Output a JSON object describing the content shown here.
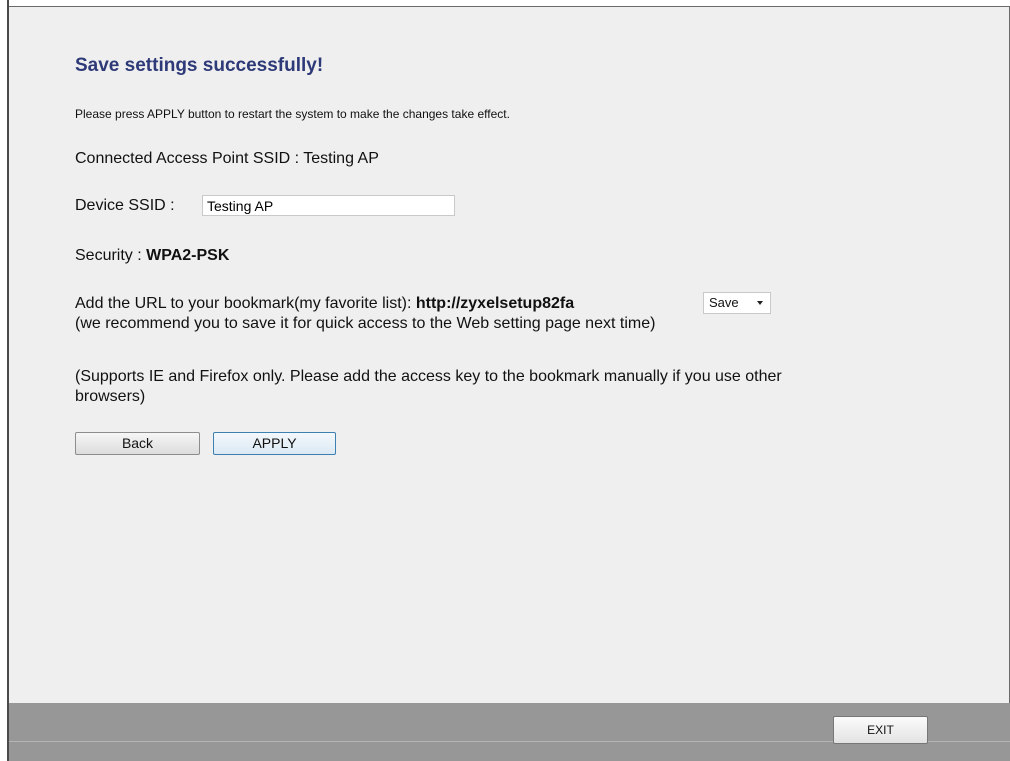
{
  "page": {
    "title": "Save settings successfully!",
    "instruction": "Please press APPLY button to restart the system to make the changes take effect."
  },
  "connection": {
    "ap_label": "Connected Access Point SSID : ",
    "ap_value": "Testing AP"
  },
  "device_ssid": {
    "label": "Device SSID : ",
    "value": "Testing AP"
  },
  "security": {
    "label": "Security : ",
    "value": "WPA2-PSK"
  },
  "bookmark": {
    "label": "Add the URL to your bookmark(my favorite list): ",
    "url": "http://zyxelsetup82fa",
    "select_value": "Save",
    "recommend": "(we recommend you to save it for quick access to the Web setting page next time)"
  },
  "support": {
    "line1": "(Supports IE and Firefox only. Please add the access key to the bookmark manually if you use other",
    "line2": "browsers)"
  },
  "buttons": {
    "back": "Back",
    "apply": "APPLY",
    "exit": "EXIT"
  },
  "colors": {
    "title": "#2e3a78",
    "background": "#efefef",
    "footer": "#979797"
  }
}
